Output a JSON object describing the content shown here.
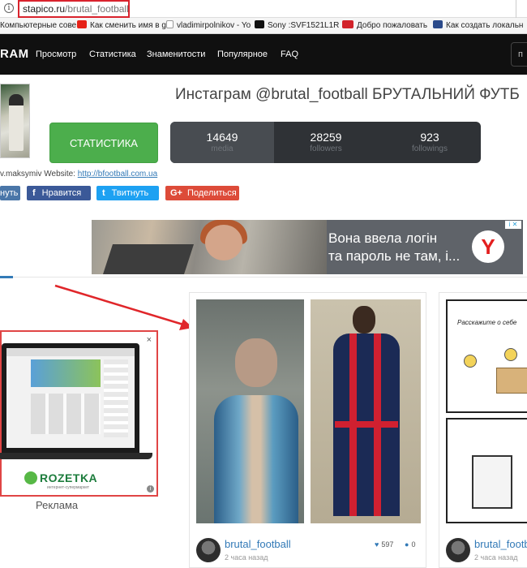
{
  "browser": {
    "url_host": "stapico.ru",
    "url_path": "/brutal_football",
    "bookmarks": [
      {
        "label": "Компьютерные сове",
        "icon": "bookmark-icon",
        "color": "#8a8a8a"
      },
      {
        "label": "Как сменить имя в g",
        "icon": "youtube-icon",
        "color": "#e62117"
      },
      {
        "label": "vladimirpolnikov - Yo",
        "icon": "page-icon",
        "color": "#999999"
      },
      {
        "label": "Sony :SVF1521L1R : Х",
        "icon": "sony-icon",
        "color": "#111111"
      },
      {
        "label": "Добро пожаловать",
        "icon": "tb-icon",
        "color": "#d2232a"
      },
      {
        "label": "Как создать локальн",
        "icon": "wiki-icon",
        "color": "#2b4a8a"
      }
    ]
  },
  "navbar": {
    "logo": "RAM",
    "items": [
      "Просмотр",
      "Статистика",
      "Знаменитости",
      "Популярное",
      "FAQ"
    ],
    "button": "п"
  },
  "profile": {
    "title": "Инстаграм @brutal_football БРУТАЛЬНИЙ ФУТБ",
    "stats_button": "СТАТИСТИКА",
    "stats": [
      {
        "value": "14649",
        "label": "media"
      },
      {
        "value": "28259",
        "label": "followers"
      },
      {
        "value": "923",
        "label": "followings"
      }
    ],
    "bio_text": "v.maksymiv Website: ",
    "bio_link": "http://bfootball.com.ua"
  },
  "share": {
    "vk": {
      "label": "нуть",
      "color": "#4a76a8"
    },
    "facebook": {
      "label": "Нравится",
      "icon": "f",
      "color": "#3b5998"
    },
    "twitter": {
      "label": "Твитнуть",
      "icon": "t",
      "color": "#1da1f2"
    },
    "gplus": {
      "label": "Поделиться",
      "icon": "G+",
      "color": "#dd4b39"
    }
  },
  "ad": {
    "line1": "Вона ввела логін",
    "line2": "та пароль не там, і...",
    "badge": "Y",
    "side_brand": "ROZETKA",
    "side_sub": "интернет-супермаркет",
    "side_label": "Реклама",
    "close": "×",
    "info": "i"
  },
  "posts": [
    {
      "user": "brutal_football",
      "time": "2 часа назад",
      "likes": "597",
      "comments": "0"
    },
    {
      "user": "brutal_footb",
      "time": "2 часа назад",
      "comic_text": "Расскажите о себе"
    }
  ],
  "colors": {
    "navbar_bg": "#101010",
    "stats_button": "#4cae4c",
    "stats_bar": "#2f3236",
    "link": "#337ab7",
    "highlight_box": "#d9232d"
  }
}
